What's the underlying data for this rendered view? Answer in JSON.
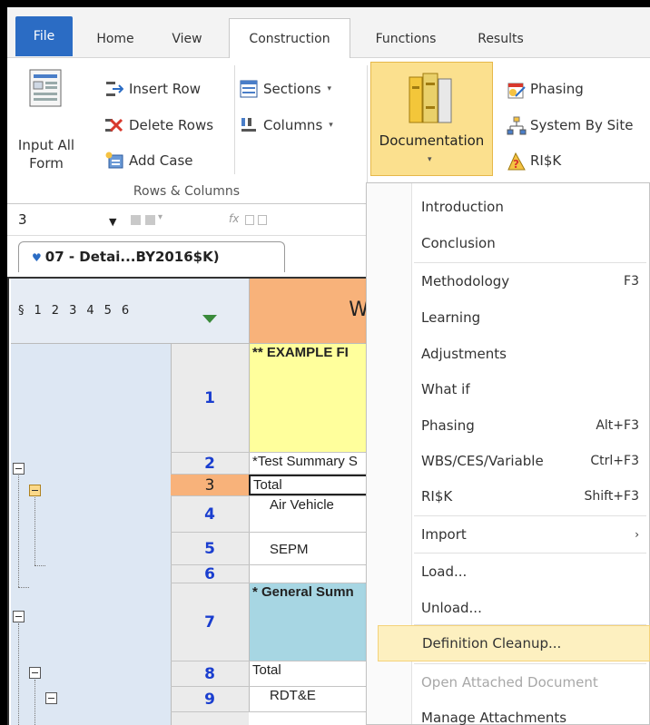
{
  "tabs": [
    "File",
    "Home",
    "View",
    "Construction",
    "Functions",
    "Results"
  ],
  "ribbon": {
    "input_all_form": "Input All\nForm",
    "insert_row": "Insert Row",
    "delete_rows": "Delete Rows",
    "add_case": "Add Case",
    "sections": "Sections",
    "columns": "Columns",
    "group_rows_columns": "Rows & Columns",
    "documentation": "Documentation",
    "phasing": "Phasing",
    "system_by_site": "System By Site",
    "risk": "RI$K"
  },
  "formula_bar": {
    "cell_ref": "3"
  },
  "sheet_tab": {
    "label": "07 - Detai...BY2016$K)"
  },
  "grid": {
    "outline_levels": [
      "§",
      "1",
      "2",
      "3",
      "4",
      "5",
      "6"
    ],
    "column_header": "W",
    "rows": [
      {
        "num": "1",
        "text": "** EXAMPLE FI",
        "bg": "#ffff9c"
      },
      {
        "num": "2",
        "text": "*Test Summary S",
        "bg": "#ffffff"
      },
      {
        "num": "3",
        "text": "Total",
        "bg": "#ffffff"
      },
      {
        "num": "4",
        "text": "Air Vehicle",
        "bg": "#ffffff"
      },
      {
        "num": "5",
        "text": "SEPM",
        "bg": "#ffffff"
      },
      {
        "num": "6",
        "text": "",
        "bg": "#ffffff"
      },
      {
        "num": "7",
        "text": "* General Sumn",
        "bg": "#a7d6e3"
      },
      {
        "num": "8",
        "text": "Total",
        "bg": "#ffffff"
      },
      {
        "num": "9",
        "text": "RDT&E",
        "bg": "#ffffff"
      }
    ]
  },
  "menu": {
    "items": [
      {
        "label": "Introduction",
        "shortcut": ""
      },
      {
        "label": "Conclusion",
        "shortcut": ""
      },
      {
        "label": "Methodology",
        "shortcut": "F3"
      },
      {
        "label": "Learning",
        "shortcut": ""
      },
      {
        "label": "Adjustments",
        "shortcut": ""
      },
      {
        "label": "What if",
        "shortcut": ""
      },
      {
        "label": "Phasing",
        "shortcut": "Alt+F3"
      },
      {
        "label": "WBS/CES/Variable",
        "shortcut": "Ctrl+F3"
      },
      {
        "label": "RI$K",
        "shortcut": "Shift+F3"
      },
      {
        "label": "Import",
        "shortcut": "›"
      },
      {
        "label": "Load...",
        "shortcut": ""
      },
      {
        "label": "Unload...",
        "shortcut": ""
      },
      {
        "label": "Definition Cleanup...",
        "shortcut": ""
      },
      {
        "label": "Open Attached Document",
        "shortcut": ""
      },
      {
        "label": "Manage Attachments",
        "shortcut": ""
      }
    ]
  },
  "colors": {
    "file_tab": "#2b6cc4",
    "highlight": "#fbe08e",
    "row_active": "#f8b27a",
    "row_num": "#1a3ecf"
  }
}
